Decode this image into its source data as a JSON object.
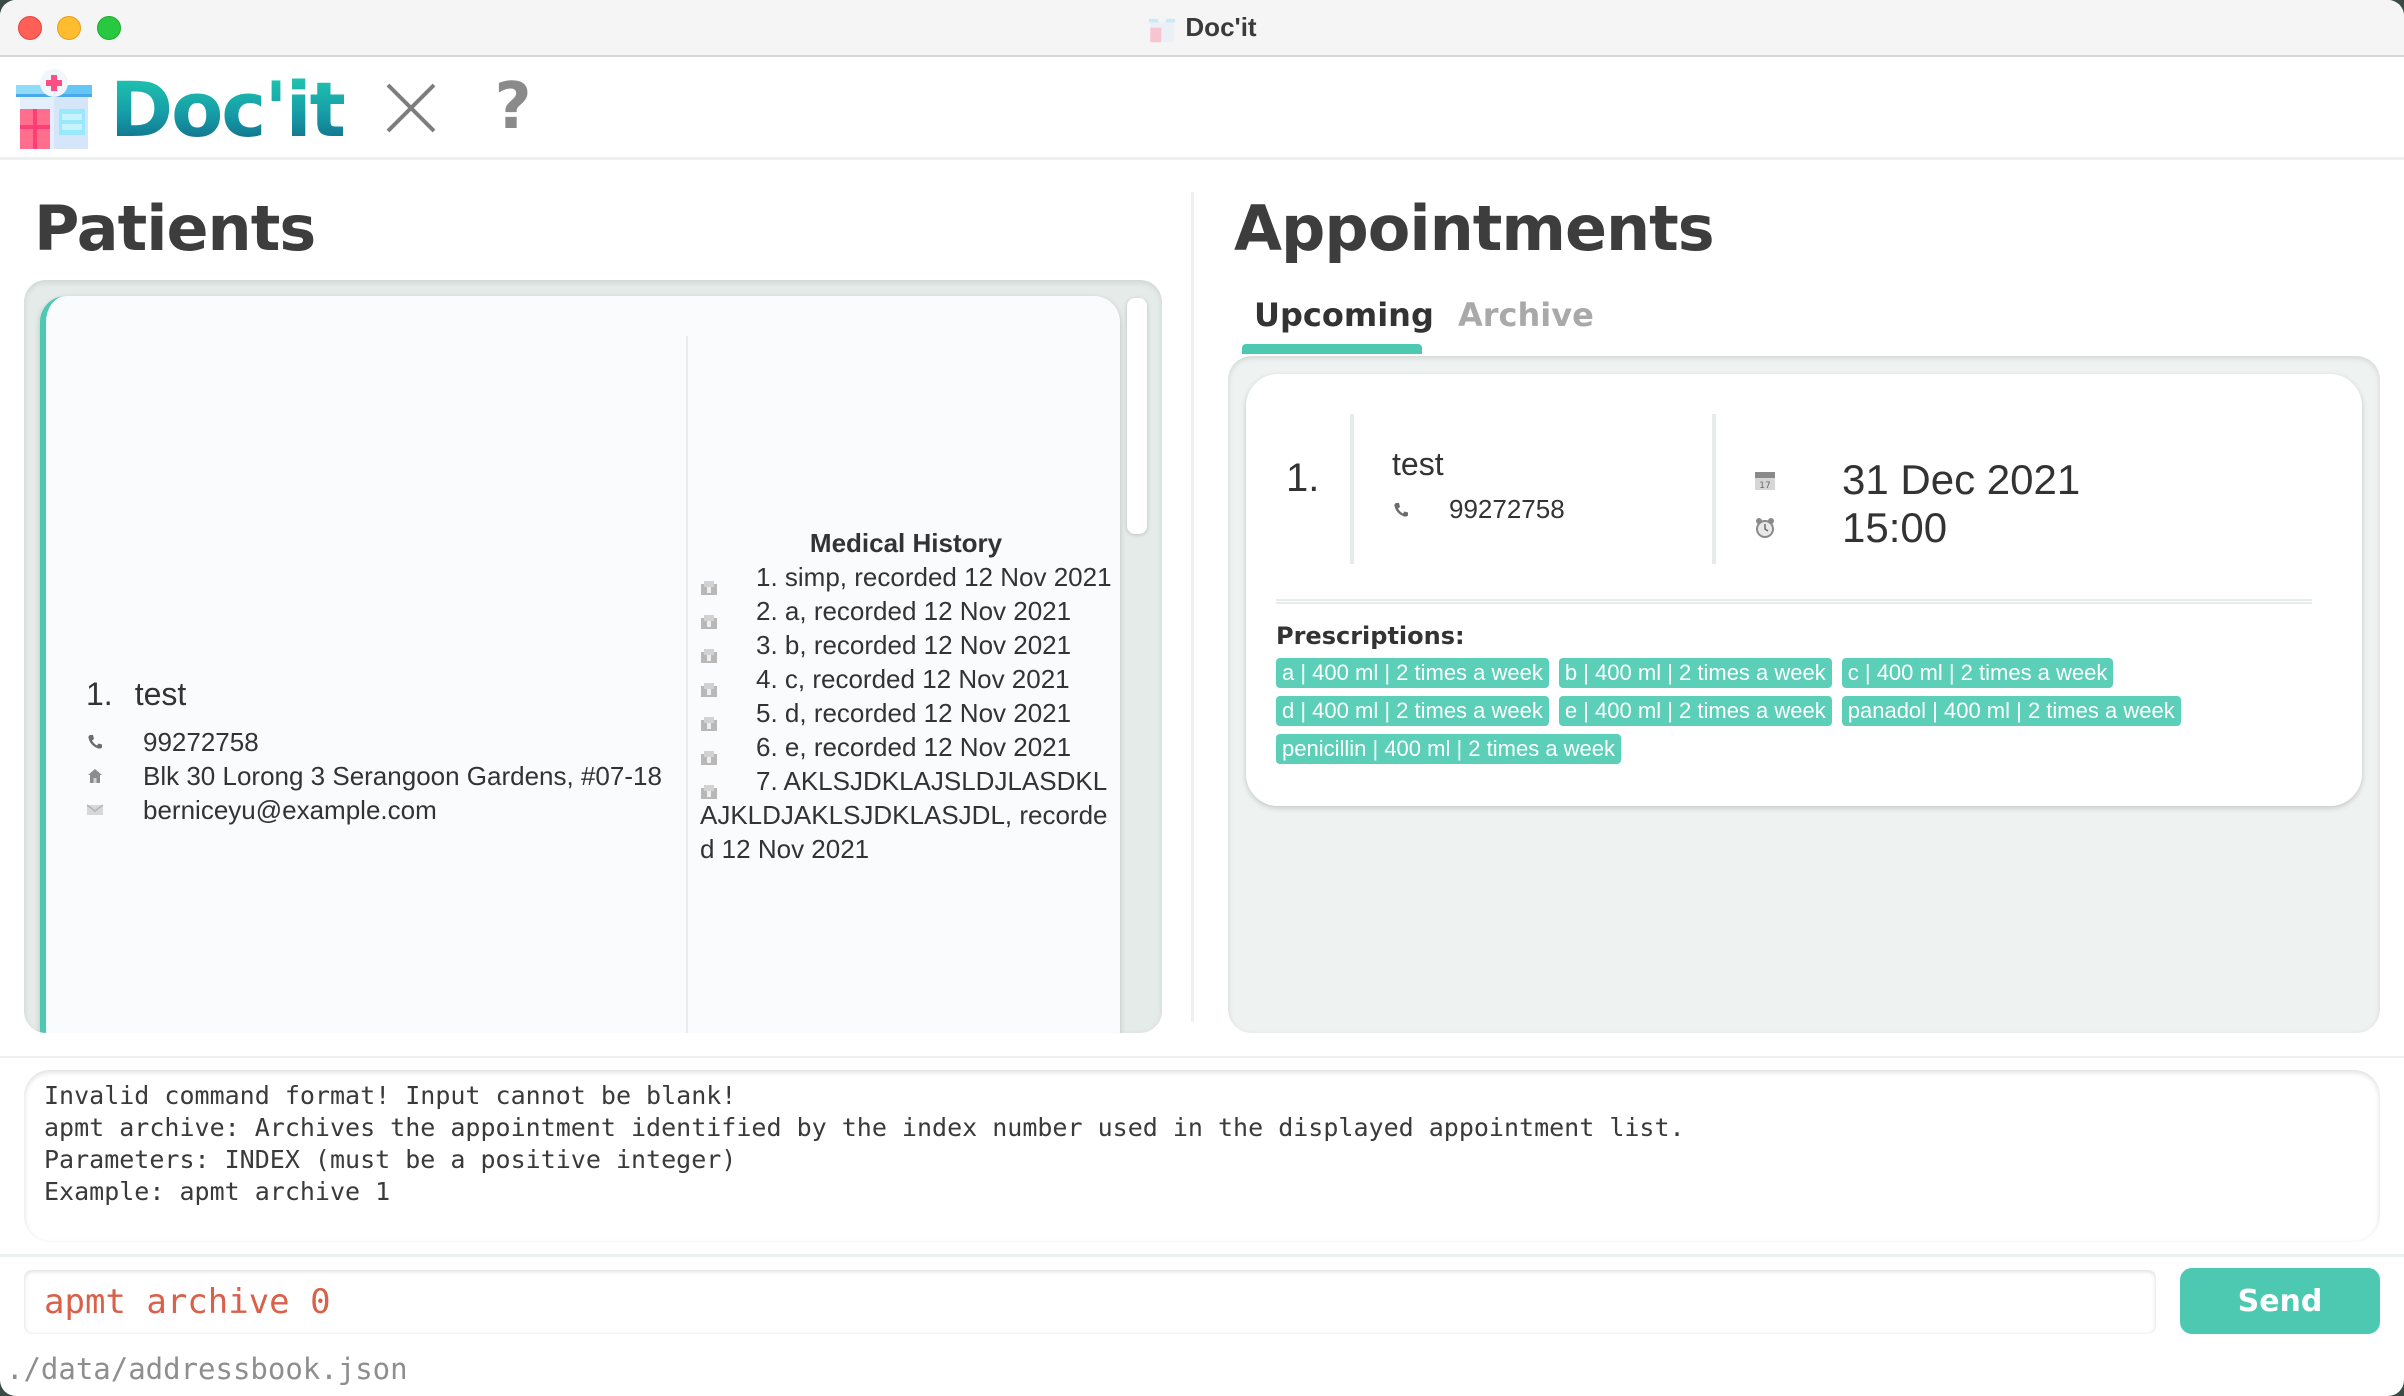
{
  "window": {
    "title": "Doc'it"
  },
  "menubar": {
    "app_name": "Doc'it",
    "close_icon": "close-x-icon",
    "help_label": "?"
  },
  "patients": {
    "title": "Patients",
    "list": [
      {
        "index": "1.",
        "name": "test",
        "phone": "99272758",
        "address": "Blk 30 Lorong 3 Serangoon Gardens, #07-18",
        "email": "berniceyu@example.com",
        "medical_history_title": "Medical History",
        "medical_history": [
          "1. simp, recorded 12 Nov 2021",
          "2. a, recorded 12 Nov 2021",
          "3. b, recorded 12 Nov 2021",
          "4. c, recorded 12 Nov 2021",
          "5. d, recorded 12 Nov 2021",
          "6. e, recorded 12 Nov 2021",
          "7. AKLSJDKLAJSLDJLASDKLAJKLDJAKLSJDKLASJDL, recorded 12 Nov 2021"
        ]
      }
    ]
  },
  "appointments": {
    "title": "Appointments",
    "tabs": [
      {
        "label": "Upcoming",
        "active": true
      },
      {
        "label": "Archive",
        "active": false
      }
    ],
    "list": [
      {
        "index": "1.",
        "patient_name": "test",
        "phone": "99272758",
        "date": "31 Dec 2021",
        "time": "15:00",
        "prescriptions_label": "Prescriptions:",
        "prescriptions": [
          "a | 400 ml | 2 times a week",
          "b | 400 ml | 2 times a week",
          "c | 400 ml | 2 times a week",
          "d | 400 ml | 2 times a week",
          "e | 400 ml | 2 times a week",
          "panadol | 400 ml | 2 times a week",
          "penicillin | 400 ml | 2 times a week"
        ]
      }
    ]
  },
  "result_display": {
    "lines": [
      "Invalid command format! Input cannot be blank!",
      "apmt archive: Archives the appointment identified by the index number used in the displayed appointment list.",
      "Parameters: INDEX (must be a positive integer)",
      "Example: apmt archive 1"
    ]
  },
  "command_box": {
    "value": "apmt archive 0",
    "send_label": "Send"
  },
  "status_bar": {
    "file_path": "./data/addressbook.json"
  },
  "colors": {
    "accent": "#4cc9b0",
    "tag": "#5ccfb8",
    "error_text": "#d9614a"
  }
}
